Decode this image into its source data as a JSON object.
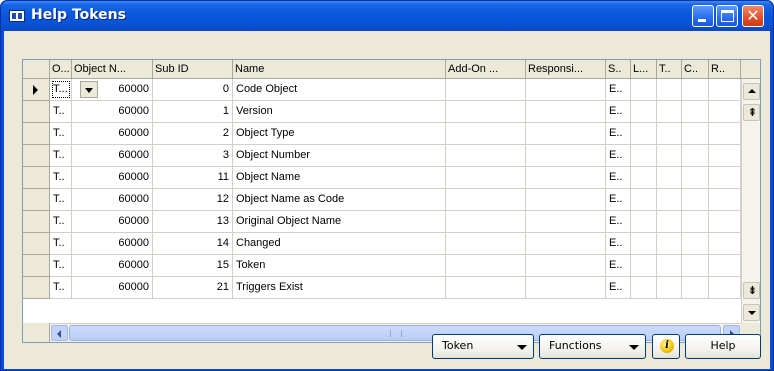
{
  "window": {
    "title": "Help Tokens"
  },
  "grid": {
    "columns": [
      "O...",
      "Object N...",
      "Sub ID",
      "Name",
      "Add-On ...",
      "Responsi...",
      "S..",
      "L...",
      "T..",
      "C..",
      "R.."
    ],
    "rows": [
      {
        "o": "T...",
        "object_no": "60000",
        "sub_id": "0",
        "name": "Code Object",
        "s": "E.."
      },
      {
        "o": "T..",
        "object_no": "60000",
        "sub_id": "1",
        "name": "Version",
        "s": "E.."
      },
      {
        "o": "T..",
        "object_no": "60000",
        "sub_id": "2",
        "name": "Object Type",
        "s": "E.."
      },
      {
        "o": "T..",
        "object_no": "60000",
        "sub_id": "3",
        "name": "Object Number",
        "s": "E.."
      },
      {
        "o": "T..",
        "object_no": "60000",
        "sub_id": "11",
        "name": "Object Name",
        "s": "E.."
      },
      {
        "o": "T..",
        "object_no": "60000",
        "sub_id": "12",
        "name": "Object Name as Code",
        "s": "E.."
      },
      {
        "o": "T..",
        "object_no": "60000",
        "sub_id": "13",
        "name": "Original Object Name",
        "s": "E.."
      },
      {
        "o": "T..",
        "object_no": "60000",
        "sub_id": "14",
        "name": "Changed",
        "s": "E.."
      },
      {
        "o": "T..",
        "object_no": "60000",
        "sub_id": "15",
        "name": "Token",
        "s": "E.."
      },
      {
        "o": "T..",
        "object_no": "60000",
        "sub_id": "21",
        "name": "Triggers Exist",
        "s": "E.."
      }
    ]
  },
  "buttons": {
    "token": "Token",
    "functions": "Functions",
    "help": "Help"
  },
  "icons": {
    "window": "table-window-icon",
    "info": "info-icon"
  }
}
